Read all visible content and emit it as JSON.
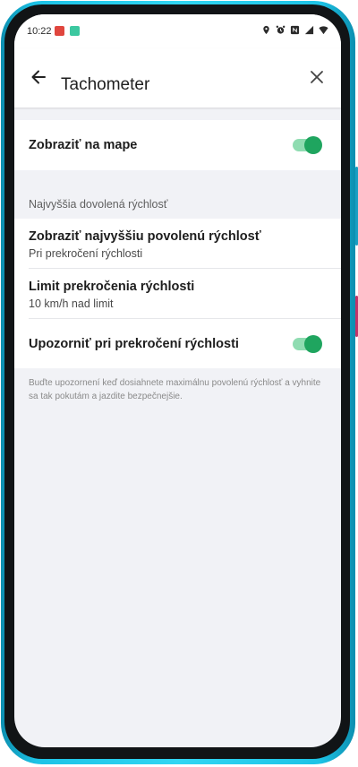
{
  "status_bar": {
    "time": "10:22",
    "icons": [
      "notification-app-icon",
      "notification-app-icon-2",
      "location-icon",
      "alarm-icon",
      "nfc-icon",
      "signal-icon",
      "wifi-icon"
    ]
  },
  "app_bar": {
    "title": "Tachometer",
    "back_icon": "arrow-left-icon",
    "close_icon": "close-icon"
  },
  "settings": {
    "show_on_map": {
      "label": "Zobraziť na mape",
      "enabled": true
    },
    "section_header": "Najvyššia dovolená rýchlosť",
    "show_speed_limit": {
      "label": "Zobraziť najvyššiu povolenú rýchlosť",
      "sub": "Pri prekročení rýchlosti"
    },
    "speeding_limit": {
      "label": "Limit prekročenia rýchlosti",
      "sub": "10 km/h nad limit"
    },
    "warn_speeding": {
      "label": "Upozorniť pri prekročení rýchlosti",
      "enabled": true
    },
    "footnote": "Buďte upozornení keď dosiahnete maximálnu povolenú rýchlosť a vyhnite sa tak pokutám a jazdite bezpečnejšie."
  },
  "colors": {
    "accent": "#1fa55f",
    "accent_track": "#8fdcb1",
    "frame": "#31d6f2",
    "background": "#f1f2f6"
  }
}
